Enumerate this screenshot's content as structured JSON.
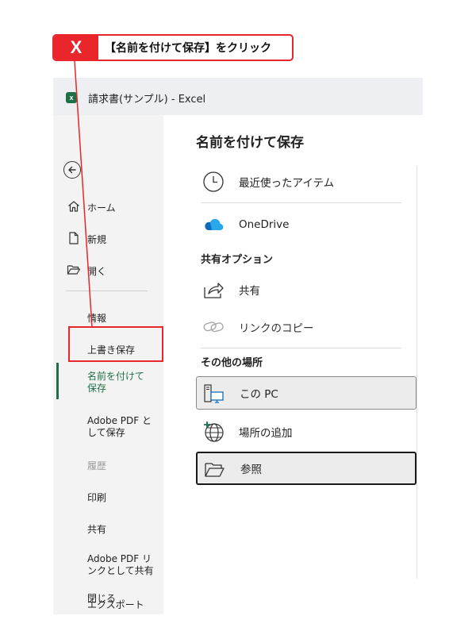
{
  "callout": {
    "badge": "X",
    "text": "【名前を付けて保存】をクリック",
    "color": "#e8262b"
  },
  "window": {
    "app_icon": "excel-icon",
    "title": "請求書(サンプル)  -  Excel"
  },
  "sidebar": {
    "items": [
      {
        "label": "ホーム",
        "icon": "home-icon"
      },
      {
        "label": "新規",
        "icon": "new-document-icon"
      },
      {
        "label": "開く",
        "icon": "open-folder-icon"
      },
      {
        "label": "情報"
      },
      {
        "label": "上書き保存"
      },
      {
        "label": "名前を付けて保存",
        "active": true
      },
      {
        "label": "Adobe PDF として保存"
      },
      {
        "label": "履歴",
        "disabled": true
      },
      {
        "label": "印刷"
      },
      {
        "label": "共有"
      },
      {
        "label": "Adobe PDF リンクとして共有"
      },
      {
        "label": "エクスポート"
      },
      {
        "label": "閉じる"
      }
    ],
    "active_color": "#1e7145"
  },
  "main": {
    "title": "名前を付けて保存",
    "recent": {
      "label": "最近使ったアイテム",
      "icon": "clock-icon"
    },
    "onedrive": {
      "label": "OneDrive",
      "icon": "onedrive-cloud-icon"
    },
    "share_heading": "共有オプション",
    "share": {
      "label": "共有",
      "icon": "share-arrow-icon"
    },
    "copy_link": {
      "label": "リンクのコピー",
      "icon": "link-icon"
    },
    "other_heading": "その他の場所",
    "this_pc": {
      "label": "この PC",
      "icon": "computer-icon"
    },
    "add_place": {
      "label": "場所の追加",
      "icon": "add-place-globe-icon"
    },
    "browse": {
      "label": "参照",
      "icon": "folder-icon"
    }
  }
}
